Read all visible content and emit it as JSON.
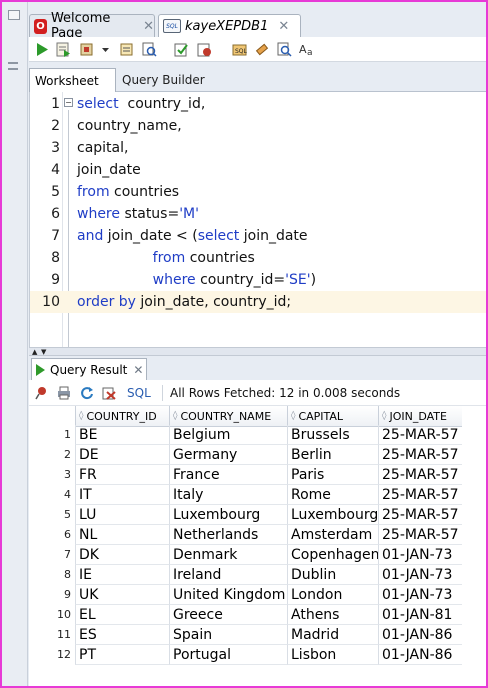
{
  "tabs": [
    {
      "label": "Welcome Page",
      "icon": "oracle-icon",
      "close": "✕"
    },
    {
      "label": "kayeXEPDB1",
      "icon": "sql-worksheet-icon",
      "close": "✕"
    }
  ],
  "toolbar": {
    "icons": [
      "run-statement-icon",
      "run-script-icon",
      "autotrace-icon",
      "dropdown-arrow-icon",
      "explain-plan-icon",
      "sql-tuning-icon",
      "commit-icon",
      "rollback-icon",
      "unshared-sql-icon",
      "clear-icon",
      "find-icon",
      "format-icon"
    ]
  },
  "worksheet_tabs": {
    "active": "Worksheet",
    "inactive": "Query Builder"
  },
  "editor": {
    "current_line": 10,
    "lines": [
      {
        "num": "1",
        "tokens": [
          {
            "t": "select",
            "k": "kw"
          },
          {
            "t": "  country_id,",
            "k": "plain"
          }
        ]
      },
      {
        "num": "2",
        "tokens": [
          {
            "t": "country_name,",
            "k": "plain"
          }
        ]
      },
      {
        "num": "3",
        "tokens": [
          {
            "t": "capital,",
            "k": "plain"
          }
        ]
      },
      {
        "num": "4",
        "tokens": [
          {
            "t": "join_date",
            "k": "plain"
          }
        ]
      },
      {
        "num": "5",
        "tokens": [
          {
            "t": "from",
            "k": "kw"
          },
          {
            "t": " countries",
            "k": "plain"
          }
        ]
      },
      {
        "num": "6",
        "tokens": [
          {
            "t": "where",
            "k": "kw"
          },
          {
            "t": " status=",
            "k": "plain"
          },
          {
            "t": "'M'",
            "k": "str"
          }
        ]
      },
      {
        "num": "7",
        "tokens": [
          {
            "t": "and",
            "k": "kw"
          },
          {
            "t": " join_date < (",
            "k": "plain"
          },
          {
            "t": "select",
            "k": "kw"
          },
          {
            "t": " join_date",
            "k": "plain"
          }
        ]
      },
      {
        "num": "8",
        "tokens": [
          {
            "t": "                 ",
            "k": "plain"
          },
          {
            "t": "from",
            "k": "kw"
          },
          {
            "t": " countries",
            "k": "plain"
          }
        ]
      },
      {
        "num": "9",
        "tokens": [
          {
            "t": "                 ",
            "k": "plain"
          },
          {
            "t": "where",
            "k": "kw"
          },
          {
            "t": " country_id=",
            "k": "plain"
          },
          {
            "t": "'SE'",
            "k": "str"
          },
          {
            "t": ")",
            "k": "plain"
          }
        ]
      },
      {
        "num": "10",
        "tokens": [
          {
            "t": "order by",
            "k": "kw"
          },
          {
            "t": " join_date, country_id;",
            "k": "plain"
          }
        ]
      }
    ]
  },
  "result": {
    "tab_label": "Query Result",
    "tab_close": "✕",
    "sql_link": "SQL",
    "status": "All Rows Fetched: 12 in 0.008 seconds",
    "columns": [
      "COUNTRY_ID",
      "COUNTRY_NAME",
      "CAPITAL",
      "JOIN_DATE"
    ],
    "rows": [
      [
        "1",
        "BE",
        "Belgium",
        "Brussels",
        "25-MAR-57"
      ],
      [
        "2",
        "DE",
        "Germany",
        "Berlin",
        "25-MAR-57"
      ],
      [
        "3",
        "FR",
        "France",
        "Paris",
        "25-MAR-57"
      ],
      [
        "4",
        "IT",
        "Italy",
        "Rome",
        "25-MAR-57"
      ],
      [
        "5",
        "LU",
        "Luxembourg",
        "Luxembourg",
        "25-MAR-57"
      ],
      [
        "6",
        "NL",
        "Netherlands",
        "Amsterdam",
        "25-MAR-57"
      ],
      [
        "7",
        "DK",
        "Denmark",
        "Copenhagen",
        "01-JAN-73"
      ],
      [
        "8",
        "IE",
        "Ireland",
        "Dublin",
        "01-JAN-73"
      ],
      [
        "9",
        "UK",
        "United Kingdom",
        "London",
        "01-JAN-73"
      ],
      [
        "10",
        "EL",
        "Greece",
        "Athens",
        "01-JAN-81"
      ],
      [
        "11",
        "ES",
        "Spain",
        "Madrid",
        "01-JAN-86"
      ],
      [
        "12",
        "PT",
        "Portugal",
        "Lisbon",
        "01-JAN-86"
      ]
    ]
  },
  "colors": {
    "frame_border": "#e73ad6",
    "keyword": "#1f3dc6",
    "current_line": "#fdf6e4",
    "oracle_red": "#d21f1f"
  }
}
